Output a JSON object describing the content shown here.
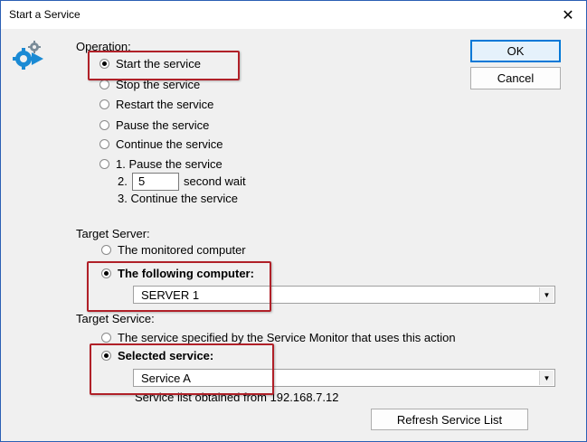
{
  "window": {
    "title": "Start a Service"
  },
  "operation": {
    "heading": "Operation:",
    "options": [
      "Start the service",
      "Stop the service",
      "Restart the service",
      "Pause the service",
      "Continue the service",
      "1. Pause the service"
    ],
    "selected_index": 0,
    "wait_prefix": "2.",
    "wait_value": "5",
    "wait_suffix": "second wait",
    "continue_step": "3. Continue the service"
  },
  "buttons": {
    "ok": "OK",
    "cancel": "Cancel",
    "refresh": "Refresh Service List"
  },
  "target_server": {
    "heading": "Target Server:",
    "option_monitored": "The monitored computer",
    "option_following": "The following computer:",
    "computer_value": "SERVER 1"
  },
  "target_service": {
    "heading": "Target Service:",
    "option_specified": "The service specified by the Service Monitor that uses this action",
    "option_selected": "Selected service:",
    "service_value": "Service A",
    "list_source": "Service list obtained from 192.168.7.12"
  },
  "colors": {
    "highlight_box": "#b02028",
    "title_border": "#2b5fb4",
    "icon_blue": "#1a8ad4"
  }
}
